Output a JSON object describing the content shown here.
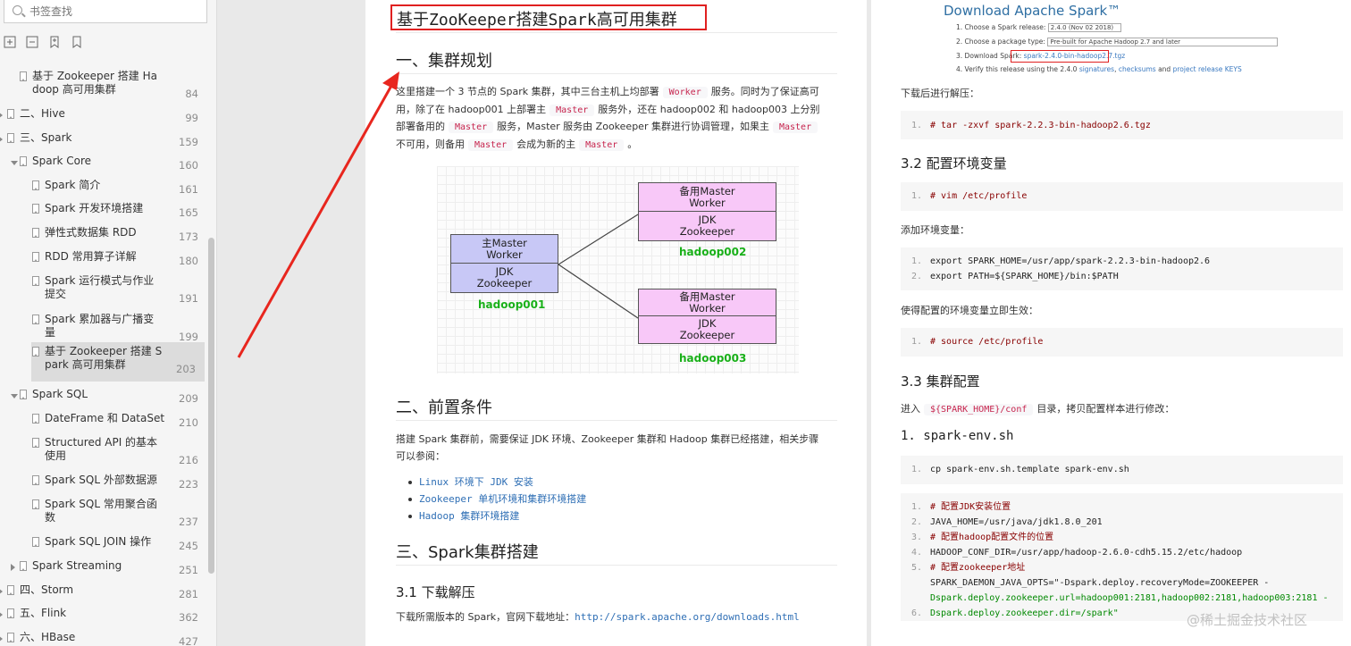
{
  "sidebar": {
    "search_placeholder": "书签查找",
    "items": [
      {
        "label_l1": "基于 Zookeeper 搭建 Ha",
        "label_l2": "doop 高可用集群",
        "page": "84"
      },
      {
        "label_l1": "二、Hive",
        "page": "99"
      },
      {
        "label_l1": "三、Spark",
        "page": "159"
      },
      {
        "label_l1": "Spark Core",
        "page": "160"
      },
      {
        "label_l1": "Spark 简介",
        "page": "161"
      },
      {
        "label_l1": "Spark 开发环境搭建",
        "page": "165"
      },
      {
        "label_l1": "弹性式数据集 RDD",
        "page": "173"
      },
      {
        "label_l1": "RDD 常用算子详解",
        "page": "180"
      },
      {
        "label_l1": "Spark 运行模式与作业",
        "label_l2": "提交",
        "page": "191"
      },
      {
        "label_l1": "Spark 累加器与广播变",
        "label_l2": "量",
        "page": "199"
      },
      {
        "label_l1": "基于 Zookeeper 搭建 S",
        "label_l2": "park 高可用集群",
        "page": "203"
      },
      {
        "label_l1": "Spark SQL",
        "page": "209"
      },
      {
        "label_l1": "DateFrame 和 DataSet",
        "page": "210"
      },
      {
        "label_l1": "Structured API 的基本",
        "label_l2": "使用",
        "page": "216"
      },
      {
        "label_l1": "Spark SQL 外部数据源",
        "page": "223"
      },
      {
        "label_l1": "Spark SQL 常用聚合函",
        "label_l2": "数",
        "page": "237"
      },
      {
        "label_l1": "Spark SQL JOIN 操作",
        "page": "245"
      },
      {
        "label_l1": "Spark Streaming",
        "page": "251"
      },
      {
        "label_l1": "四、Storm",
        "page": "281"
      },
      {
        "label_l1": "五、Flink",
        "page": "362"
      },
      {
        "label_l1": "六、HBase",
        "page": "427"
      }
    ]
  },
  "page1": {
    "doc_title": "基于ZooKeeper搭建Spark高可用集群",
    "section1": "一、集群规划",
    "intro": {
      "t1": "这里搭建一个 3 节点的 Spark 集群，其中三台主机上均部署",
      "c_worker": "Worker",
      "t2": "服务。同时为了保证高可",
      "t3": "用，除了在 hadoop001 上部署主",
      "c_master1": "Master",
      "t4": "服务外，还在 hadoop002 和 hadoop003 上分别",
      "t5": "部署备用的",
      "c_master2": "Master",
      "t6": "服务，Master 服务由 Zookeeper 集群进行协调管理，如果主",
      "c_master3": "Master",
      "t7": "不可用，则备用",
      "c_master4": "Master",
      "t8": "会成为新的主",
      "c_master5": "Master",
      "t9": "。"
    },
    "diagram": {
      "n1_top": "主Master",
      "n1_top2": "Worker",
      "n1_bot": "JDK",
      "n1_bot2": "Zookeeper",
      "n1_host": "hadoop001",
      "n2_top": "备用Master",
      "n2_top2": "Worker",
      "n2_bot": "JDK",
      "n2_bot2": "Zookeeper",
      "n2_host": "hadoop002",
      "n3_top": "备用Master",
      "n3_top2": "Worker",
      "n3_bot": "JDK",
      "n3_bot2": "Zookeeper",
      "n3_host": "hadoop003",
      "color_main": "#c8c8f6",
      "color_standby": "#f8c8f8",
      "color_host": "#19b019"
    },
    "section2": "二、前置条件",
    "prereq_l1": "搭建 Spark 集群前，需要保证 JDK 环境、Zookeeper 集群和 Hadoop 集群已经搭建，相关步骤",
    "prereq_l2": "可以参阅：",
    "links": [
      "Linux 环境下 JDK 安装",
      "Zookeeper 单机环境和集群环境搭建",
      "Hadoop 集群环境搭建"
    ],
    "section3": "三、Spark集群搭建",
    "sub31": "3.1 下载解压",
    "download_text": "下载所需版本的 Spark，官网下载地址：",
    "download_url": "http://spark.apache.org/downloads.html"
  },
  "page2": {
    "dl_title": "Download Apache Spark™",
    "dl_step1": "1. Choose a Spark release:",
    "dl_step1_val": "2.4.0 (Nov 02 2018)",
    "dl_step2": "2. Choose a package type:",
    "dl_step2_val": "Pre-built for Apache Hadoop 2.7 and later",
    "dl_step3": "3. Download Spark:",
    "dl_step3_val": "spark-2.4.0-bin-hadoop2.7.tgz",
    "dl_step4_a": "4. Verify this release using the 2.4.0",
    "dl_step4_b": "signatures",
    "dl_step4_c": "checksums",
    "dl_step4_d": "and",
    "dl_step4_e": "project release KEYS",
    "after_dl": "下载后进行解压：",
    "cmd_tar": "# tar -zxvf  spark-2.2.3-bin-hadoop2.6.tgz",
    "sub32": "3.2 配置环境变量",
    "cmd_vim": "# vim /etc/profile",
    "add_env": "添加环境变量：",
    "env1": "export SPARK_HOME=/usr/app/spark-2.2.3-bin-hadoop2.6",
    "env2": "export  PATH=${SPARK_HOME}/bin:$PATH",
    "make_effect": "使得配置的环境变量立即生效：",
    "cmd_source": "# source /etc/profile",
    "sub33": "3.3 集群配置",
    "enter_a": "进入",
    "enter_code": "${SPARK_HOME}/conf",
    "enter_b": "目录，拷贝配置样本进行修改：",
    "sub_spark_env": "1. spark-env.sh",
    "cmd_cp": " cp spark-env.sh.template spark-env.sh",
    "cfg1": "# 配置JDK安装位置",
    "cfg2": "JAVA_HOME=/usr/java/jdk1.8.0_201",
    "cfg3": "# 配置hadoop配置文件的位置",
    "cfg4": "HADOOP_CONF_DIR=/usr/app/hadoop-2.6.0-cdh5.15.2/etc/hadoop",
    "cfg5": "# 配置zookeeper地址",
    "cfg6a": "SPARK_DAEMON_JAVA_OPTS=\"-Dspark.deploy.recoveryMode=ZOOKEEPER -",
    "cfg6b": "Dspark.deploy.zookeeper.url=hadoop001:2181,hadoop002:2181,hadoop003:2181 -",
    "cfg6c": "Dspark.deploy.zookeeper.dir=/spark\"",
    "watermark": "@稀土掘金技术社区"
  },
  "line_numbers": [
    "1.",
    "2.",
    "3.",
    "4.",
    "5.",
    "6."
  ],
  "colors": {
    "accent_red": "#e02020",
    "link_blue": "#2f6fb5",
    "code_pink": "#c7254e"
  }
}
